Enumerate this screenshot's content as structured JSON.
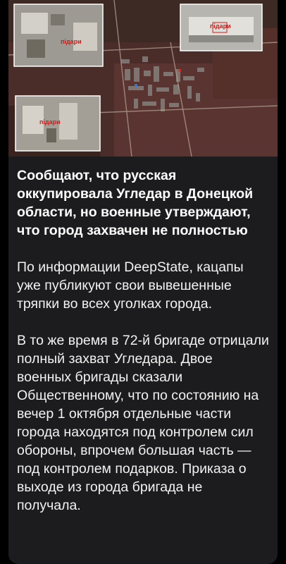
{
  "media": {
    "labels": [
      "підари",
      "підари",
      "підари"
    ]
  },
  "message": {
    "headline": "Сообщают, что русская оккупировала Угледар в Донецкой области, но военные утверждают, что город захвачен не полностью",
    "paragraphs": [
      "По информации DeepState, кацапы уже публикуют свои вывешенные тряпки во всех уголках города.",
      "В то же время в 72-й бригаде отрицали полный захват Угледара. Двое военных бригады сказали Общественному, что по состоянию на вечер 1 октября отдельные части города находятся под контролем сил обороны, впрочем большая часть — под контролем подарков. Приказа о выходе из города бригада не получала."
    ]
  }
}
